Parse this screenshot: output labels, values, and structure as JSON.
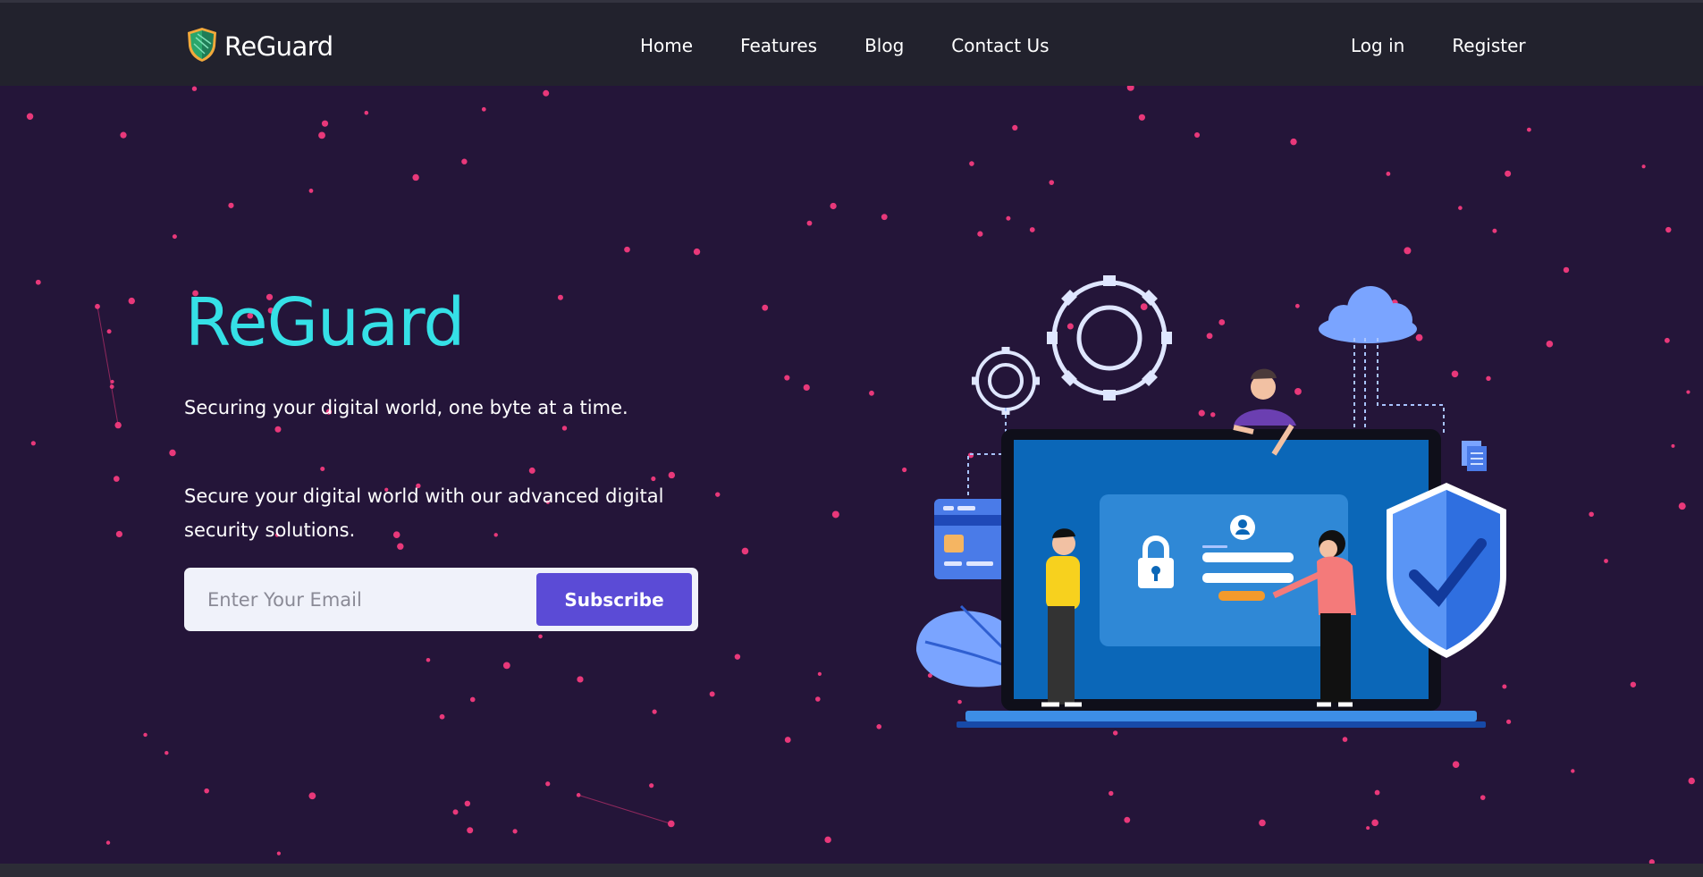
{
  "header": {
    "brand": "ReGuard",
    "nav": [
      "Home",
      "Features",
      "Blog",
      "Contact Us"
    ],
    "auth": [
      "Log in",
      "Register"
    ]
  },
  "hero": {
    "title": "ReGuard",
    "tagline": "Securing your digital world, one byte at a time.",
    "description": "Secure your digital world with our advanced digital security solutions.",
    "email_placeholder": "Enter Your Email",
    "subscribe_label": "Subscribe"
  },
  "colors": {
    "header_bg": "#22222d",
    "hero_bg": "#241539",
    "title": "#35e0e6",
    "button": "#5b4bd6",
    "network_nodes": "#e8387a"
  },
  "icons": {
    "logo": "shield-icon",
    "illustration": "cybersecurity-laptop-illustration"
  }
}
